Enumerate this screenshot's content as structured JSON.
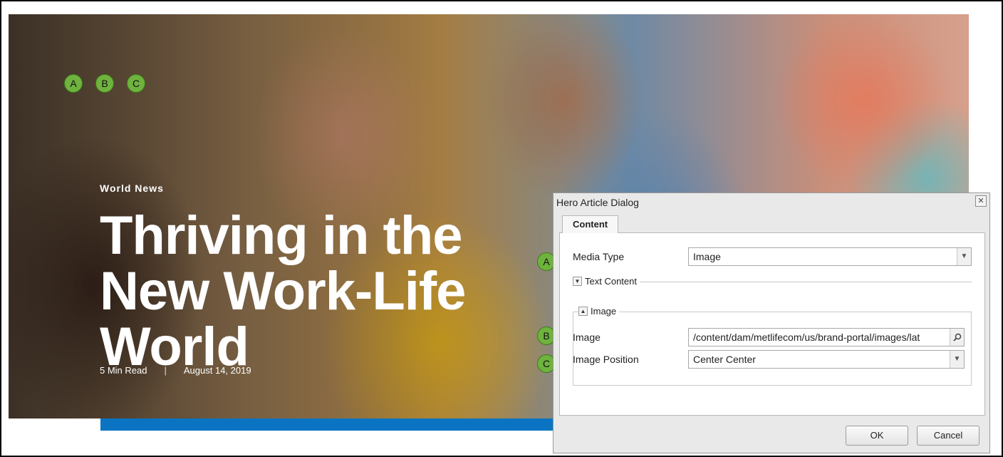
{
  "hero": {
    "category": "World News",
    "headline": "Thriving in the New Work-Life World",
    "read_time": "5 Min Read",
    "separator": "|",
    "date": "August 14, 2019"
  },
  "markers": {
    "a": "A",
    "b": "B",
    "c": "C"
  },
  "dialog": {
    "title": "Hero Article Dialog",
    "close_glyph": "✕",
    "tab": "Content",
    "media_type_label": "Media Type",
    "media_type_value": "Image",
    "text_content_legend": "Text Content",
    "image_legend": "Image",
    "image_label": "Image",
    "image_value": "/content/dam/metlifecom/us/brand-portal/images/lat",
    "image_position_label": "Image Position",
    "image_position_value": "Center Center",
    "ok_label": "OK",
    "cancel_label": "Cancel"
  },
  "colors": {
    "accent_blue": "#0a74c2",
    "marker_green": "#6fb33e"
  }
}
